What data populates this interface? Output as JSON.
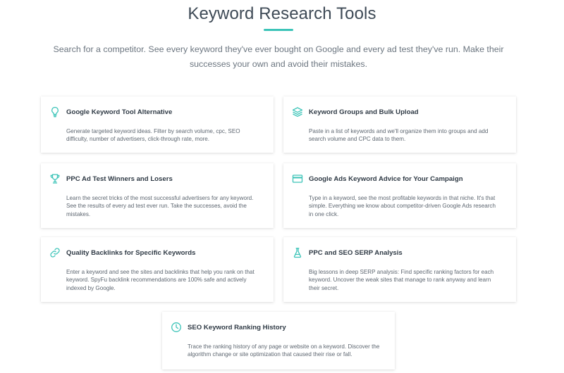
{
  "header": {
    "title": "Keyword Research Tools",
    "subtitle": "Search for a competitor. See every keyword they've ever bought on Google and every ad test they've run. Make their successes your own and avoid their mistakes."
  },
  "accent_color": "#3cc4b8",
  "cards": [
    {
      "icon": "lightbulb-icon",
      "title": "Google Keyword Tool Alternative",
      "description": "Generate targeted keyword ideas. Filter by search volume, cpc, SEO difficulty, number of advertisers, click-through rate, more."
    },
    {
      "icon": "layers-icon",
      "title": "Keyword Groups and Bulk Upload",
      "description": "Paste in a list of keywords and we'll organize them into groups and add search volume and CPC data to them."
    },
    {
      "icon": "trophy-icon",
      "title": "PPC Ad Test Winners and Losers",
      "description": "Learn the secret tricks of the most successful advertisers for any keyword. See the results of every ad test ever run. Take the successes, avoid the mistakes."
    },
    {
      "icon": "credit-card-icon",
      "title": "Google Ads Keyword Advice for Your Campaign",
      "description": "Type in a keyword, see the most profitable keywords in that niche. It's that simple. Everything we know about competitor-driven Google Ads research in one click."
    },
    {
      "icon": "link-icon",
      "title": "Quality Backlinks for Specific Keywords",
      "description": "Enter a keyword and see the sites and backlinks that help you rank on that keyword. SpyFu backlink recommendations are 100% safe and actively indexed by Google."
    },
    {
      "icon": "flask-icon",
      "title": "PPC and SEO SERP Analysis",
      "description": "Big lessons in deep SERP analysis: Find specific ranking factors for each keyword. Uncover the weak sites that manage to rank anyway and learn their secret."
    },
    {
      "icon": "clock-icon",
      "title": "SEO Keyword Ranking History",
      "description": "Trace the ranking history of any page or website on a keyword. Discover the algorithm change or site optimization that caused their rise or fall."
    }
  ]
}
